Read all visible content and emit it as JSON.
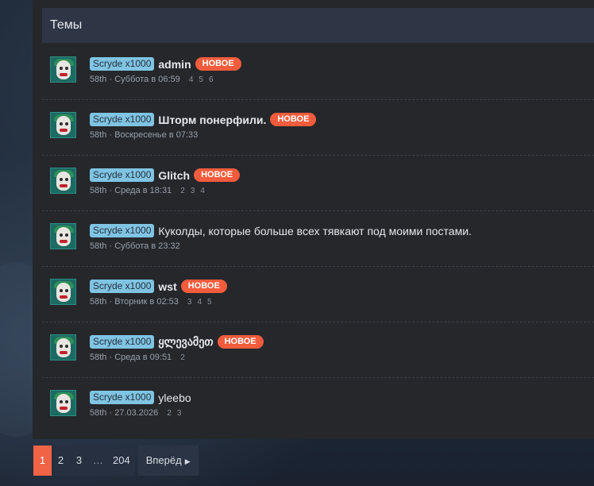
{
  "header": {
    "title": "Темы"
  },
  "threads": [
    {
      "prefix": "Scryde x1000",
      "title": "admin",
      "bold": true,
      "badge": "НОВОЕ",
      "author": "58th",
      "time": "Суббота в 06:59",
      "pages": [
        "4",
        "5",
        "6"
      ]
    },
    {
      "prefix": "Scryde x1000",
      "title": "Шторм понерфили.",
      "bold": true,
      "badge": "НОВОЕ",
      "author": "58th",
      "time": "Воскресенье в 07:33",
      "pages": []
    },
    {
      "prefix": "Scryde x1000",
      "title": "Glitch",
      "bold": true,
      "badge": "НОВОЕ",
      "author": "58th",
      "time": "Среда в 18:31",
      "pages": [
        "2",
        "3",
        "4"
      ]
    },
    {
      "prefix": "Scryde x1000",
      "title": "Куколды, которые больше всех тявкают под моими постами.",
      "bold": false,
      "badge": "",
      "author": "58th",
      "time": "Суббота в 23:32",
      "pages": []
    },
    {
      "prefix": "Scryde x1000",
      "title": "wst",
      "bold": true,
      "badge": "НОВОЕ",
      "author": "58th",
      "time": "Вторник в 02:53",
      "pages": [
        "3",
        "4",
        "5"
      ]
    },
    {
      "prefix": "Scryde x1000",
      "title": "ყლევამეთ",
      "bold": true,
      "badge": "НОВОЕ",
      "author": "58th",
      "time": "Среда в 09:51",
      "pages": [
        "2"
      ]
    },
    {
      "prefix": "Scryde x1000",
      "title": "yleebo",
      "bold": false,
      "badge": "",
      "author": "58th",
      "time": "27.03.2026",
      "pages": [
        "2",
        "3"
      ]
    }
  ],
  "pagination": {
    "pages": [
      "1",
      "2",
      "3"
    ],
    "ellipsis": "…",
    "last": "204",
    "next_label": "Вперёд",
    "next_icon": "chevron-right-icon",
    "active": "1"
  },
  "colors": {
    "accent": "#f06445",
    "prefix_bg": "#7fc4e3",
    "badge": "#f25c3c"
  }
}
